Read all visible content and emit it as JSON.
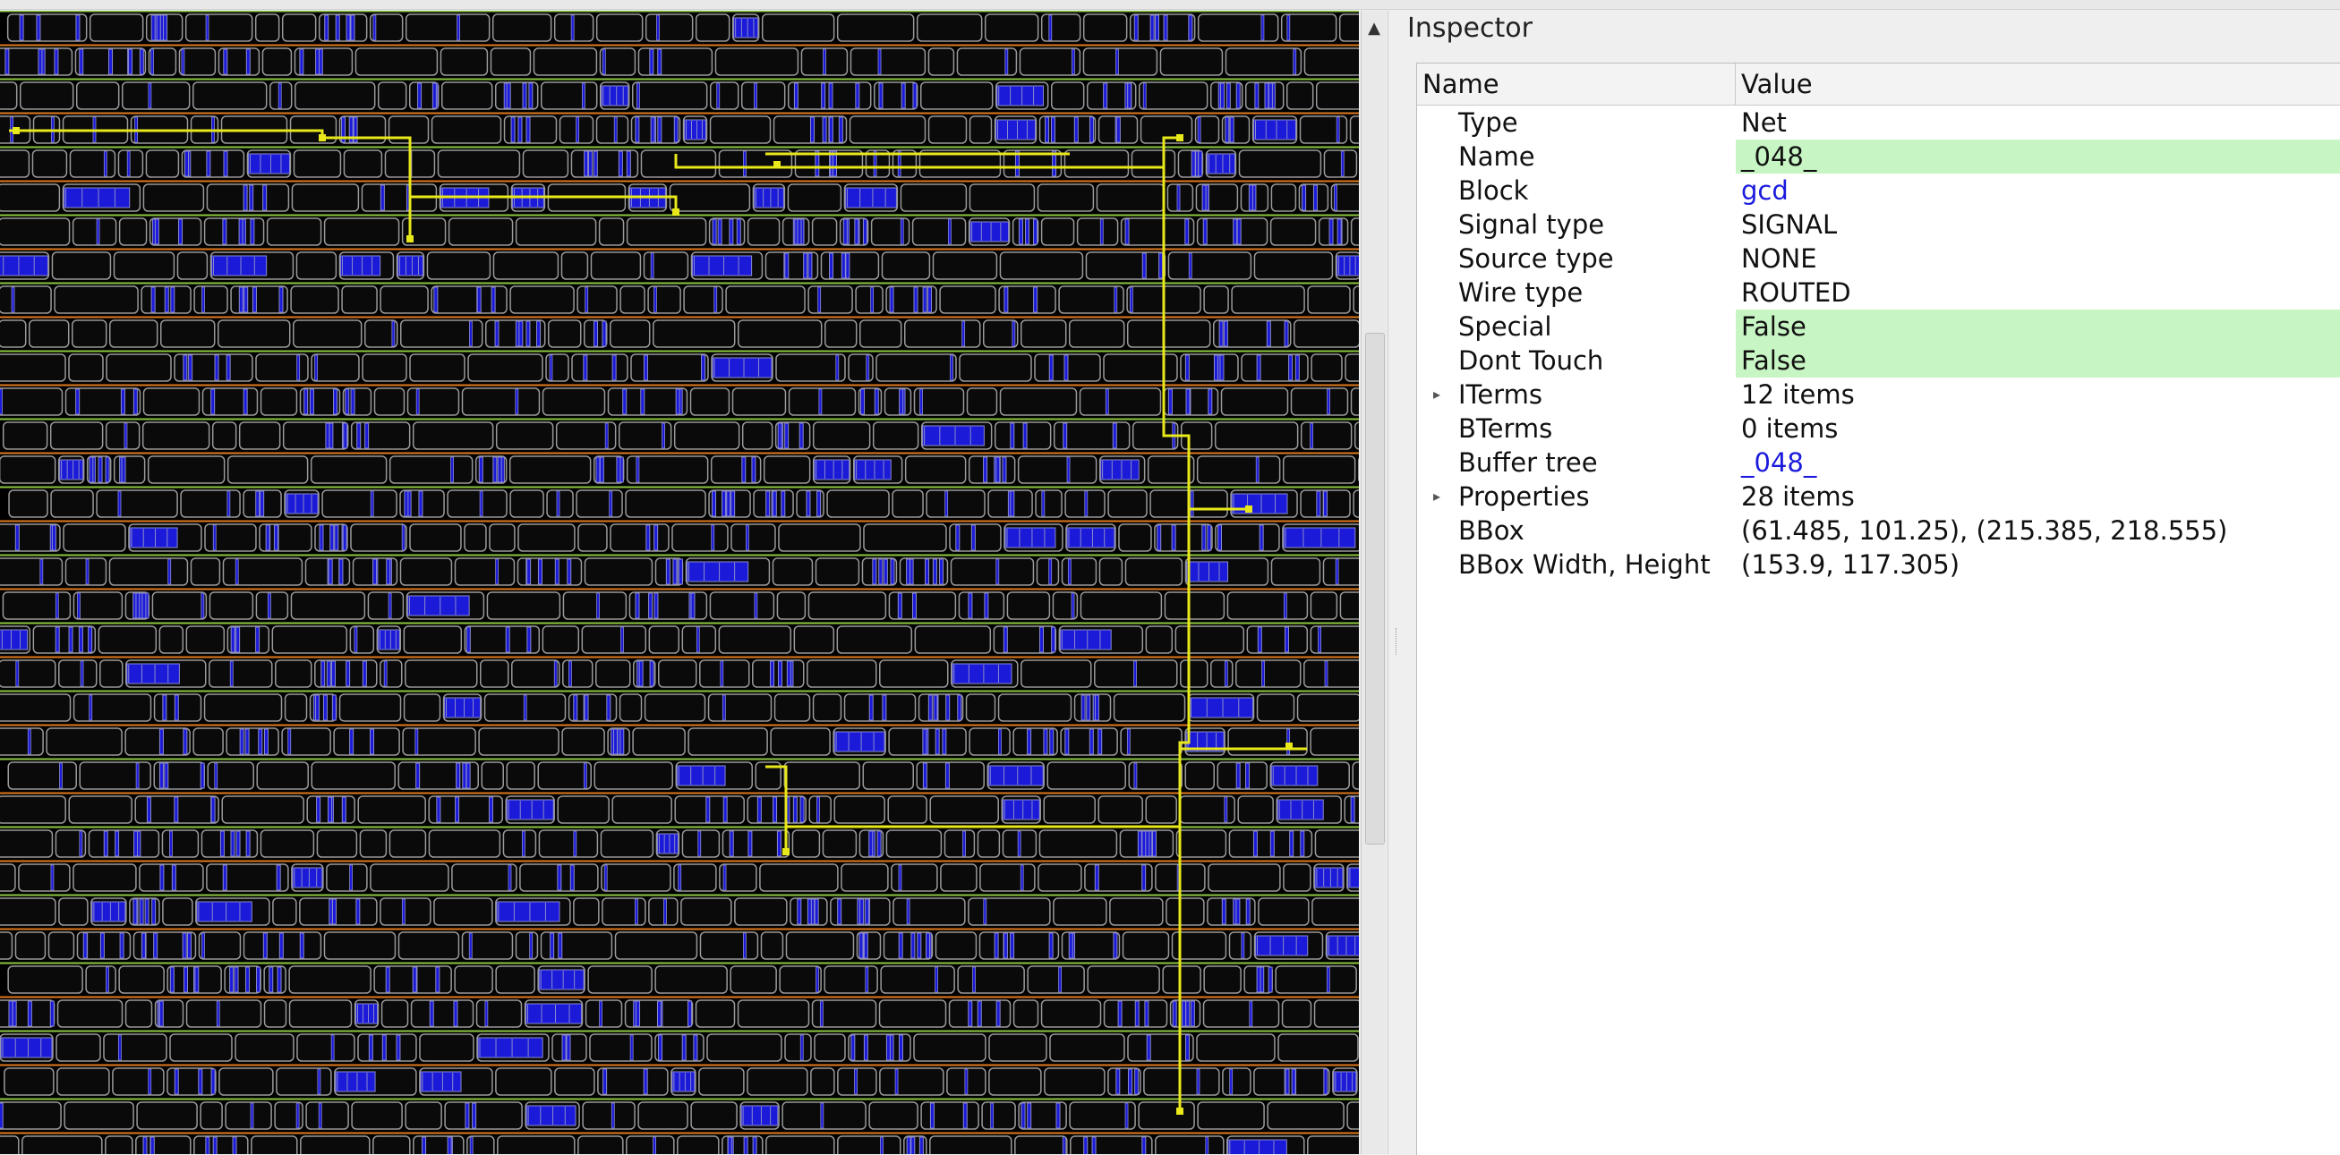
{
  "inspector": {
    "title": "Inspector",
    "columns": {
      "name": "Name",
      "value": "Value"
    },
    "rows": [
      {
        "name": "Type",
        "value": "Net",
        "highlight": false,
        "link": false,
        "expandable": false
      },
      {
        "name": "Name",
        "value": "_048_",
        "highlight": true,
        "link": false,
        "expandable": false
      },
      {
        "name": "Block",
        "value": "gcd",
        "highlight": false,
        "link": true,
        "expandable": false
      },
      {
        "name": "Signal type",
        "value": "SIGNAL",
        "highlight": false,
        "link": false,
        "expandable": false
      },
      {
        "name": "Source type",
        "value": "NONE",
        "highlight": false,
        "link": false,
        "expandable": false
      },
      {
        "name": "Wire type",
        "value": "ROUTED",
        "highlight": false,
        "link": false,
        "expandable": false
      },
      {
        "name": "Special",
        "value": "False",
        "highlight": true,
        "link": false,
        "expandable": false
      },
      {
        "name": "Dont Touch",
        "value": "False",
        "highlight": true,
        "link": false,
        "expandable": false
      },
      {
        "name": "ITerms",
        "value": "12 items",
        "highlight": false,
        "link": false,
        "expandable": true
      },
      {
        "name": "BTerms",
        "value": "0 items",
        "highlight": false,
        "link": false,
        "expandable": false
      },
      {
        "name": "Buffer tree",
        "value": "_048_",
        "highlight": false,
        "link": true,
        "expandable": false
      },
      {
        "name": "Properties",
        "value": "28 items",
        "highlight": false,
        "link": false,
        "expandable": true
      },
      {
        "name": "BBox",
        "value": "(61.485, 101.25), (215.385, 218.555)",
        "highlight": false,
        "link": false,
        "expandable": false
      },
      {
        "name": "BBox Width, Height",
        "value": "(153.9, 117.305)",
        "highlight": false,
        "link": false,
        "expandable": false
      }
    ]
  },
  "layout": {
    "colors": {
      "background": "#000000",
      "row_power": "#8cc63f",
      "row_ground": "#e07a1f",
      "cell_outline": "#9a9a9a",
      "cell_fill": "#0a0a0a",
      "metal": "#1a1ad8",
      "via_lines": "#8a8acc",
      "selected_net": "#e8e81a"
    },
    "icons": {
      "scroll_up": "arrow-up-icon",
      "expand": "triangle-right-icon"
    },
    "glyphs": {
      "scroll_up": "▲",
      "expand": "▸"
    }
  }
}
